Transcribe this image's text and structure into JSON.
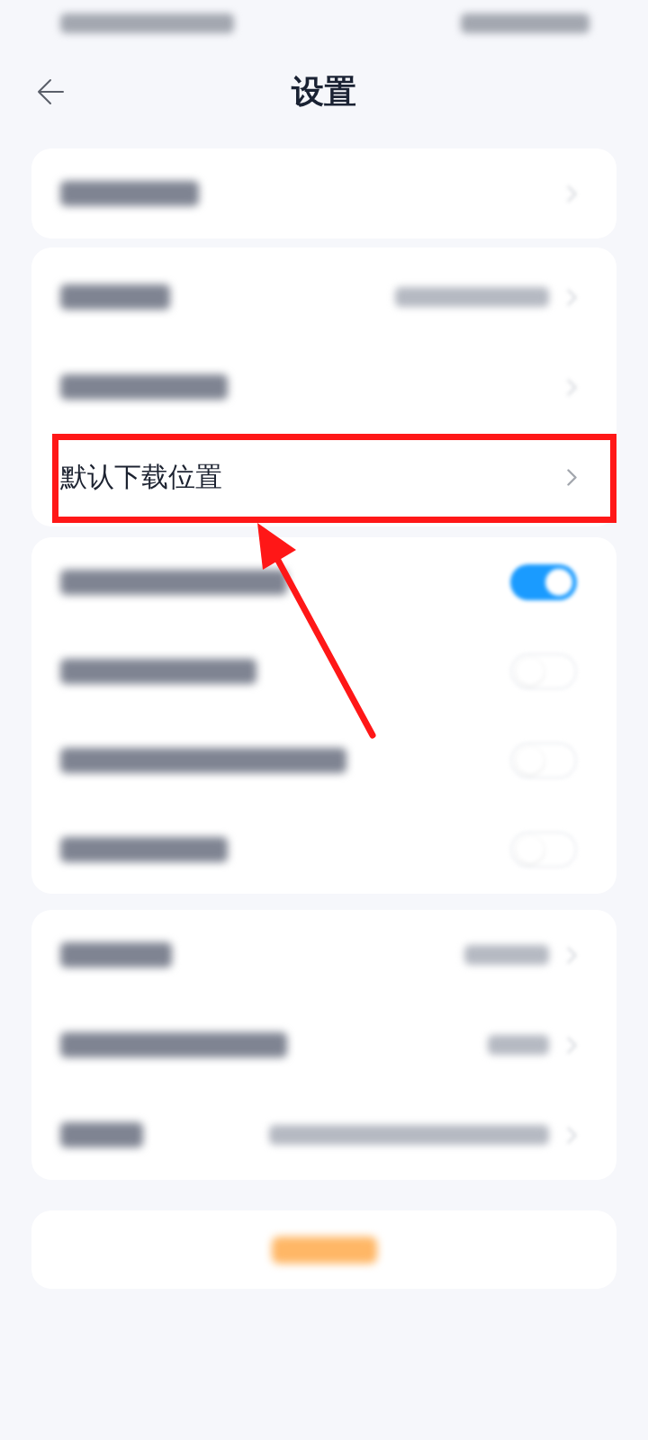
{
  "status_bar": {
    "blurred": true
  },
  "header": {
    "title": "设置"
  },
  "groups": [
    {
      "rows": [
        {
          "kind": "link",
          "blurred": true
        }
      ]
    },
    {
      "rows": [
        {
          "kind": "link",
          "blurred": true,
          "value_blurred": true
        },
        {
          "kind": "link",
          "blurred": true
        },
        {
          "kind": "link",
          "blurred": false,
          "label": "默认下载位置",
          "highlighted": true
        }
      ]
    },
    {
      "rows": [
        {
          "kind": "toggle",
          "blurred": true,
          "on": true
        },
        {
          "kind": "toggle",
          "blurred": true,
          "on": false
        },
        {
          "kind": "toggle",
          "blurred": true,
          "on": false
        },
        {
          "kind": "toggle",
          "blurred": true,
          "on": false
        }
      ]
    },
    {
      "rows": [
        {
          "kind": "link",
          "blurred": true,
          "value_blurred": true
        },
        {
          "kind": "link",
          "blurred": true,
          "value_blurred": true
        },
        {
          "kind": "link",
          "blurred": true,
          "value_blurred": true
        }
      ]
    }
  ],
  "logout_button": {
    "blurred": true
  },
  "annotations": [
    {
      "kind": "arrow"
    }
  ]
}
